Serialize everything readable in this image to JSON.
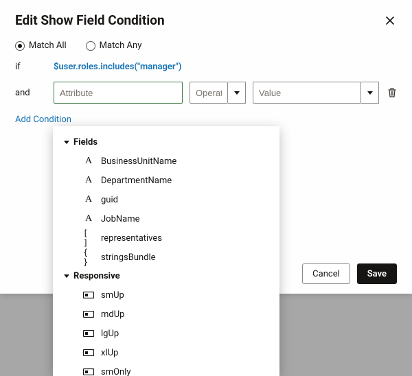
{
  "dialog": {
    "title": "Edit Show Field Condition",
    "match_all_label": "Match All",
    "match_any_label": "Match Any",
    "if_label": "if",
    "and_label": "and",
    "expression": "$user.roles.includes(\"manager\")",
    "attribute_placeholder": "Attribute",
    "operator_placeholder": "Operator",
    "value_placeholder": "Value",
    "add_condition_label": "Add Condition",
    "cancel_label": "Cancel",
    "save_label": "Save"
  },
  "dropdown": {
    "groups": [
      {
        "label": "Fields",
        "items": [
          {
            "type": "A",
            "label": "BusinessUnitName"
          },
          {
            "type": "A",
            "label": "DepartmentName"
          },
          {
            "type": "A",
            "label": "guid"
          },
          {
            "type": "A",
            "label": "JobName"
          },
          {
            "type": "array",
            "label": "representatives"
          },
          {
            "type": "object",
            "label": "stringsBundle"
          }
        ]
      },
      {
        "label": "Responsive",
        "items": [
          {
            "type": "resp",
            "label": "smUp"
          },
          {
            "type": "resp",
            "label": "mdUp"
          },
          {
            "type": "resp",
            "label": "lgUp"
          },
          {
            "type": "resp",
            "label": "xlUp"
          },
          {
            "type": "resp",
            "label": "smOnly"
          }
        ]
      }
    ]
  }
}
